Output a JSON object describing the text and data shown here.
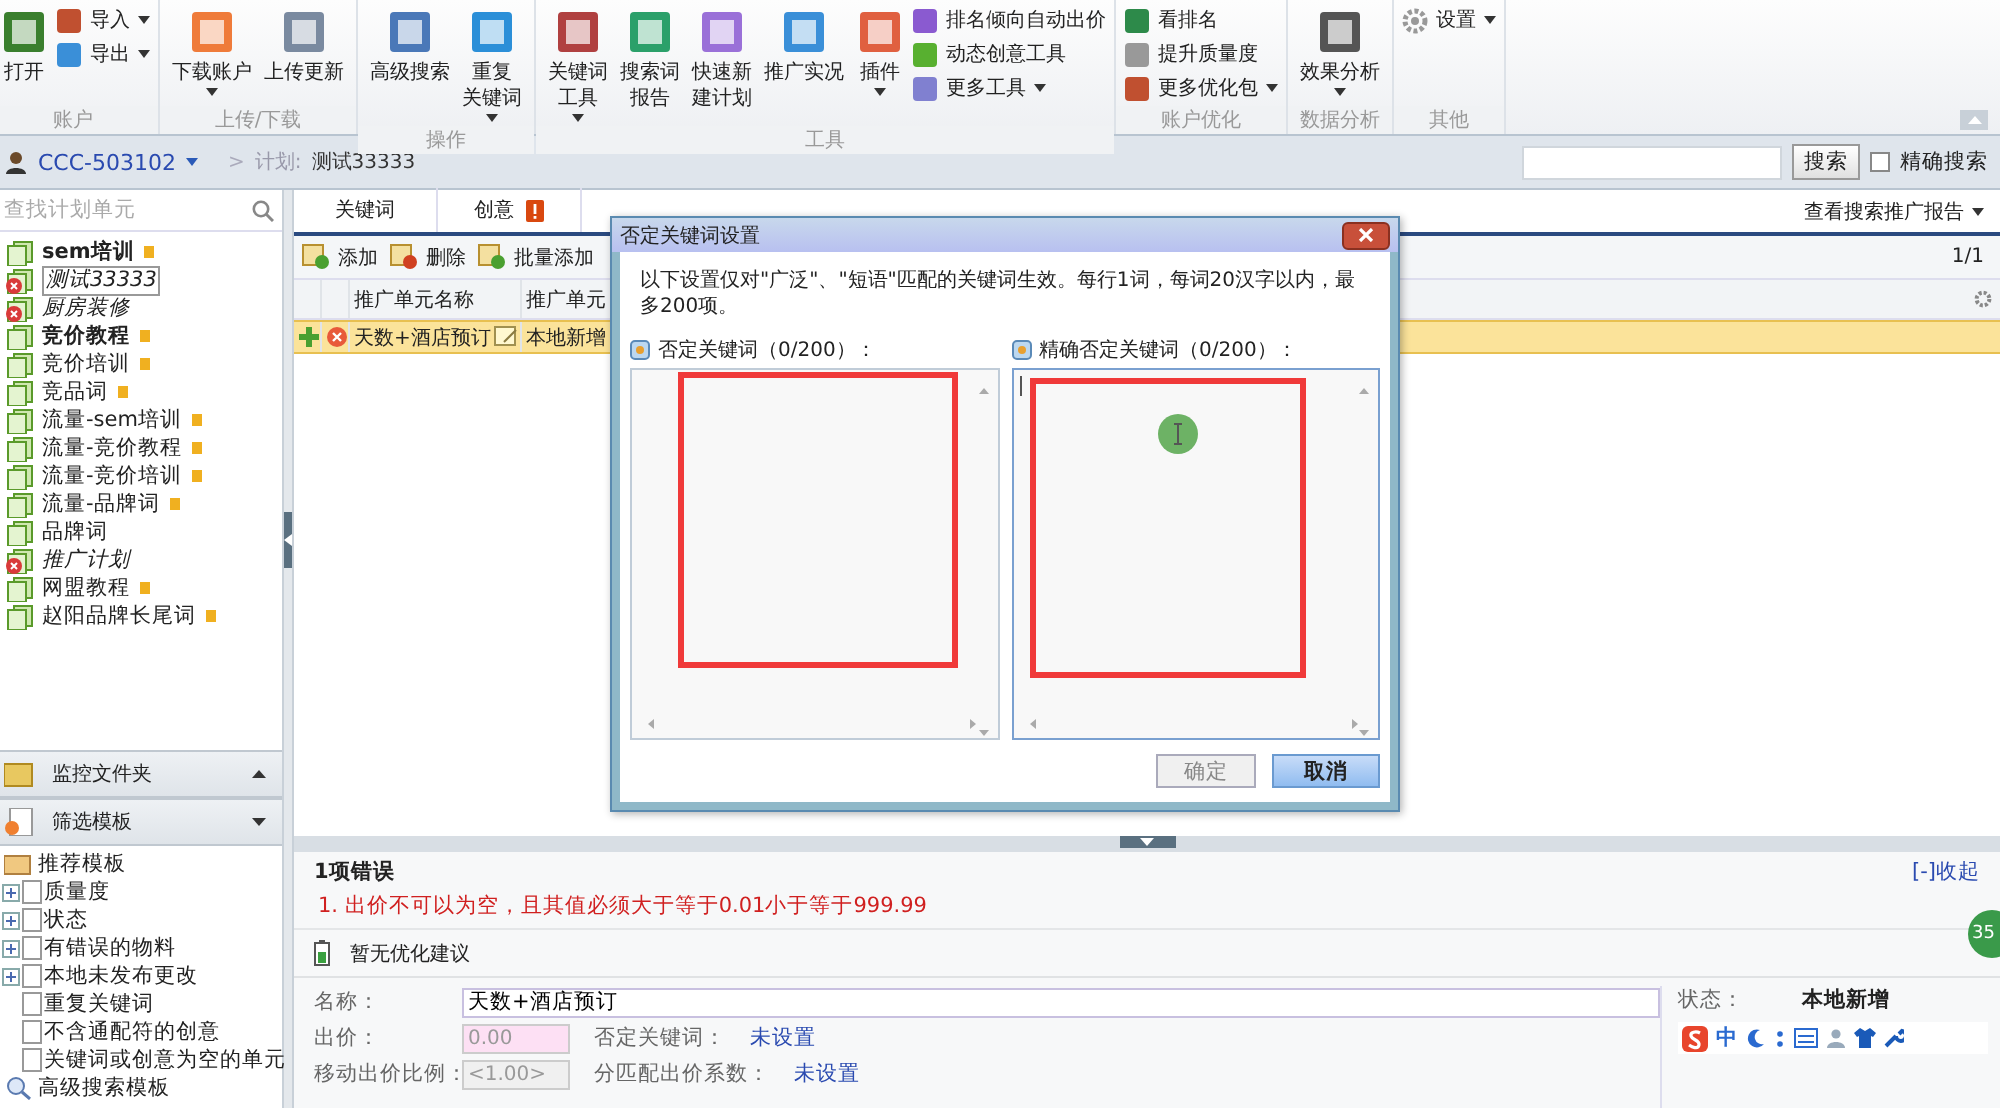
{
  "ribbon": {
    "groups": [
      {
        "label": "账户",
        "items": [
          {
            "kind": "large",
            "lines": [
              "打开"
            ],
            "dropdown": false
          },
          {
            "kind": "stack",
            "items": [
              {
                "label": "导入",
                "dropdown": true
              },
              {
                "label": "导出",
                "dropdown": true
              }
            ]
          }
        ]
      },
      {
        "label": "上传/下载",
        "items": [
          {
            "kind": "large",
            "lines": [
              "下载账户"
            ],
            "dropdown": true
          },
          {
            "kind": "large",
            "lines": [
              "上传更新"
            ],
            "dropdown": false
          }
        ]
      },
      {
        "label": "操作",
        "items": [
          {
            "kind": "large",
            "lines": [
              "高级搜索"
            ],
            "dropdown": false
          },
          {
            "kind": "large",
            "lines": [
              "重复",
              "关键词"
            ],
            "dropdown": true
          }
        ]
      },
      {
        "label": "工具",
        "items": [
          {
            "kind": "large",
            "lines": [
              "关键词",
              "工具"
            ],
            "dropdown": true
          },
          {
            "kind": "large",
            "lines": [
              "搜索词",
              "报告"
            ],
            "dropdown": false
          },
          {
            "kind": "large",
            "lines": [
              "快速新",
              "建计划"
            ],
            "dropdown": false
          },
          {
            "kind": "large",
            "lines": [
              "推广实况"
            ],
            "dropdown": false
          },
          {
            "kind": "large",
            "lines": [
              "插件"
            ],
            "dropdown": true
          },
          {
            "kind": "stack",
            "items": [
              {
                "label": "排名倾向自动出价",
                "dropdown": false
              },
              {
                "label": "动态创意工具",
                "dropdown": false
              },
              {
                "label": "更多工具",
                "dropdown": true
              }
            ]
          }
        ]
      },
      {
        "label": "账户优化",
        "items": [
          {
            "kind": "stack",
            "items": [
              {
                "label": "看排名",
                "dropdown": false
              },
              {
                "label": "提升质量度",
                "dropdown": false
              },
              {
                "label": "更多优化包",
                "dropdown": true
              }
            ]
          }
        ]
      },
      {
        "label": "数据分析",
        "items": [
          {
            "kind": "large",
            "lines": [
              "效果分析"
            ],
            "dropdown": true
          }
        ]
      },
      {
        "label": "其他",
        "items": [
          {
            "kind": "small",
            "label": "设置",
            "dropdown": true
          }
        ]
      }
    ]
  },
  "breadcrumb": {
    "account": "CCC-503102",
    "separator": ">",
    "plan_label": "计划:",
    "plan": "测试33333"
  },
  "search": {
    "button": "搜索",
    "exact_label": "精确搜索",
    "exact_checked": false
  },
  "sidebar": {
    "search_placeholder": "查找计划单元",
    "plans": [
      {
        "label": "sem培训",
        "bold": true,
        "paused": false,
        "flag": true,
        "selected": false
      },
      {
        "label": "测试33333",
        "bold": false,
        "paused": true,
        "flag": false,
        "selected": true
      },
      {
        "label": "厨房装修",
        "bold": false,
        "paused": true,
        "flag": false,
        "selected": false
      },
      {
        "label": "竞价教程",
        "bold": true,
        "paused": false,
        "flag": true,
        "selected": false
      },
      {
        "label": "竞价培训",
        "bold": false,
        "paused": false,
        "flag": true,
        "selected": false
      },
      {
        "label": "竞品词",
        "bold": false,
        "paused": false,
        "flag": true,
        "selected": false
      },
      {
        "label": "流量-sem培训",
        "bold": false,
        "paused": false,
        "flag": true,
        "selected": false
      },
      {
        "label": "流量-竞价教程",
        "bold": false,
        "paused": false,
        "flag": true,
        "selected": false
      },
      {
        "label": "流量-竞价培训",
        "bold": false,
        "paused": false,
        "flag": true,
        "selected": false
      },
      {
        "label": "流量-品牌词",
        "bold": false,
        "paused": false,
        "flag": true,
        "selected": false
      },
      {
        "label": "品牌词",
        "bold": false,
        "paused": false,
        "flag": false,
        "selected": false
      },
      {
        "label": "推广计划",
        "bold": false,
        "paused": true,
        "flag": false,
        "selected": false
      },
      {
        "label": "网盟教程",
        "bold": false,
        "paused": false,
        "flag": true,
        "selected": false
      },
      {
        "label": "赵阳品牌长尾词",
        "bold": false,
        "paused": false,
        "flag": true,
        "selected": false
      }
    ],
    "panels": [
      {
        "label": "监控文件夹",
        "expanded": false
      },
      {
        "label": "筛选模板",
        "expanded": true
      }
    ],
    "templates": [
      {
        "label": "推荐模板",
        "kind": "folder",
        "children": [
          {
            "label": "质量度",
            "expandable": true
          },
          {
            "label": "状态",
            "expandable": true
          },
          {
            "label": "有错误的物料",
            "expandable": true
          },
          {
            "label": "本地未发布更改",
            "expandable": true
          },
          {
            "label": "重复关键词",
            "expandable": false
          },
          {
            "label": "不含通配符的创意",
            "expandable": false
          },
          {
            "label": "关键词或创意为空的单元",
            "expandable": false
          }
        ]
      },
      {
        "label": "高级搜索模板",
        "kind": "search"
      }
    ]
  },
  "tabs": [
    {
      "label": "关键词",
      "selected": false,
      "warning": false
    },
    {
      "label": "创意",
      "selected": false,
      "warning": true
    }
  ],
  "report_link": "查看搜索推广报告",
  "toolbar": [
    "添加",
    "删除",
    "批量添加"
  ],
  "pager": "1/1",
  "table": {
    "columns": [
      "推广单元名称",
      "推广单元"
    ],
    "rows": [
      {
        "cells": [
          "天数+酒店预订",
          "本地新增"
        ],
        "selected": true
      }
    ]
  },
  "errors": {
    "title": "1项错误",
    "collapse": "[-]收起",
    "items": [
      "1. 出价不可以为空，且其值必须大于等于0.01小于等于999.99"
    ],
    "suggestion": "暂无优化建议"
  },
  "form": {
    "name_label": "名称：",
    "name": "天数+酒店预订",
    "bid_label": "出价：",
    "bid": "0.00",
    "bid_invalid": true,
    "mobile_label": "移动出价比例：",
    "mobile": "<1.00>",
    "neg_label": "否定关键词：",
    "neg_value": "未设置",
    "match_label": "分匹配出价系数：",
    "match_value": "未设置",
    "status_label": "状态：",
    "status": "本地新增"
  },
  "dialog": {
    "title": "否定关键词设置",
    "note": "以下设置仅对\"广泛\"、\"短语\"匹配的关键词生效。每行1词，每词20汉字以内，最多200项。",
    "fields": [
      {
        "label": "否定关键词（0/200）：",
        "focused": false
      },
      {
        "label": "精确否定关键词（0/200）：",
        "focused": true
      }
    ],
    "buttons": [
      {
        "label": "确定",
        "kind": "secondary"
      },
      {
        "label": "取消",
        "kind": "primary"
      }
    ]
  },
  "ime": {
    "mode": "中"
  },
  "floating_badge": "35"
}
